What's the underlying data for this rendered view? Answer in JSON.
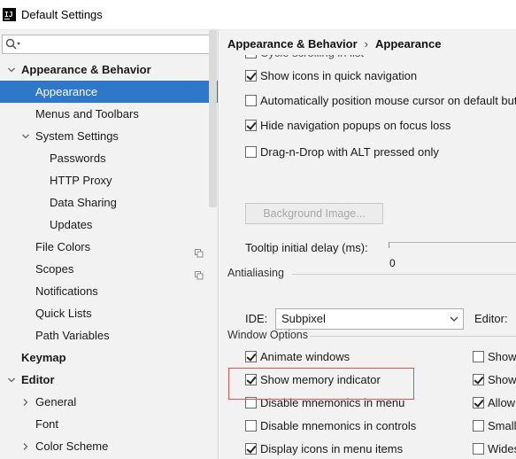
{
  "window": {
    "title": "Default Settings",
    "app_icon_text": "IJ"
  },
  "sidebar": {
    "search": {
      "value": "",
      "placeholder": ""
    },
    "tree": [
      {
        "label": "Appearance & Behavior",
        "level": 0,
        "expanded": true,
        "bold": true,
        "selected": false,
        "copy": false
      },
      {
        "label": "Appearance",
        "level": 1,
        "expanded": null,
        "bold": false,
        "selected": true,
        "copy": false
      },
      {
        "label": "Menus and Toolbars",
        "level": 1,
        "expanded": null,
        "bold": false,
        "selected": false,
        "copy": false
      },
      {
        "label": "System Settings",
        "level": 1,
        "expanded": true,
        "bold": false,
        "selected": false,
        "copy": false
      },
      {
        "label": "Passwords",
        "level": 2,
        "expanded": null,
        "bold": false,
        "selected": false,
        "copy": false
      },
      {
        "label": "HTTP Proxy",
        "level": 2,
        "expanded": null,
        "bold": false,
        "selected": false,
        "copy": false
      },
      {
        "label": "Data Sharing",
        "level": 2,
        "expanded": null,
        "bold": false,
        "selected": false,
        "copy": false
      },
      {
        "label": "Updates",
        "level": 2,
        "expanded": null,
        "bold": false,
        "selected": false,
        "copy": false
      },
      {
        "label": "File Colors",
        "level": 1,
        "expanded": null,
        "bold": false,
        "selected": false,
        "copy": true
      },
      {
        "label": "Scopes",
        "level": 1,
        "expanded": null,
        "bold": false,
        "selected": false,
        "copy": true
      },
      {
        "label": "Notifications",
        "level": 1,
        "expanded": null,
        "bold": false,
        "selected": false,
        "copy": false
      },
      {
        "label": "Quick Lists",
        "level": 1,
        "expanded": null,
        "bold": false,
        "selected": false,
        "copy": false
      },
      {
        "label": "Path Variables",
        "level": 1,
        "expanded": null,
        "bold": false,
        "selected": false,
        "copy": false
      },
      {
        "label": "Keymap",
        "level": 0,
        "expanded": null,
        "bold": true,
        "selected": false,
        "copy": false
      },
      {
        "label": "Editor",
        "level": 0,
        "expanded": true,
        "bold": true,
        "selected": false,
        "copy": false
      },
      {
        "label": "General",
        "level": 1,
        "expanded": false,
        "bold": false,
        "selected": false,
        "copy": false
      },
      {
        "label": "Font",
        "level": 1,
        "expanded": null,
        "bold": false,
        "selected": false,
        "copy": false
      },
      {
        "label": "Color Scheme",
        "level": 1,
        "expanded": false,
        "bold": false,
        "selected": false,
        "copy": false
      }
    ]
  },
  "main": {
    "breadcrumb": {
      "parent": "Appearance & Behavior",
      "separator": "›",
      "current": "Appearance"
    },
    "partial_top_option": "Cycle scrolling in list",
    "ui_options": [
      {
        "label": "Show icons in quick navigation",
        "checked": true
      },
      {
        "label": "Automatically position mouse cursor on default button",
        "checked": false
      },
      {
        "label": "Hide navigation popups on focus loss",
        "checked": true
      },
      {
        "label": "Drag-n-Drop with ALT pressed only",
        "checked": false
      }
    ],
    "background_image_button": "Background Image...",
    "tooltip": {
      "label": "Tooltip initial delay (ms):",
      "min_label": "0"
    },
    "antialiasing": {
      "title": "Antialiasing",
      "ide_label": "IDE:",
      "ide_value": "Subpixel",
      "editor_label": "Editor:"
    },
    "window_options": {
      "title": "Window Options",
      "left": [
        {
          "label": "Animate windows",
          "checked": true
        },
        {
          "label": "Show memory indicator",
          "checked": true
        },
        {
          "label": "Disable mnemonics in menu",
          "checked": false
        },
        {
          "label": "Disable mnemonics in controls",
          "checked": false
        },
        {
          "label": "Display icons in menu items",
          "checked": true
        }
      ],
      "right": [
        {
          "label": "Show tool window bars",
          "checked": false
        },
        {
          "label": "Show tool window numbers",
          "checked": true
        },
        {
          "label": "Allow merging buttons",
          "checked": true
        },
        {
          "label": "Small labels in editor tabs",
          "checked": false
        },
        {
          "label": "Widescreen tool window layout",
          "checked": false
        }
      ]
    }
  },
  "colors": {
    "selection": "#2f77c8",
    "highlight_box": "#e05050"
  }
}
